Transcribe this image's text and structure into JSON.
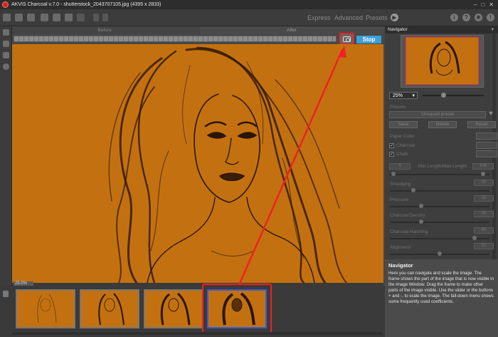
{
  "window": {
    "title": "AKVIS Charcoal v.7.0 - shutterstock_2043707105.jpg (4395 x 2833)"
  },
  "toolbar": {
    "modes": [
      "Express",
      "Advanced",
      "Presets"
    ]
  },
  "view_tabs": {
    "before": "Before",
    "after": "After"
  },
  "progress": {
    "stop_label": "Stop",
    "fraction": 1.0
  },
  "canvas": {
    "zoom_readout": "25.0%"
  },
  "navigator": {
    "title": "Navigator",
    "zoom_value": "25%"
  },
  "settings": {
    "presets_label": "Presets",
    "preset_selected": "Unsaved preset",
    "save_label": "Save",
    "delete_label": "Delete",
    "reset_label": "Reset",
    "paper_color_label": "Paper Color",
    "charcoal_label": "Charcoal",
    "chalk_label": "Chalk",
    "min_max_label": "Min Length/Max Length",
    "min_length_value": "5",
    "max_length_value": "100",
    "smudging_label": "Smudging",
    "smudging_value": "20",
    "pressure_label": "Pressure",
    "pressure_value": "30",
    "charcoal_density_label": "Charcoal Density",
    "charcoal_density_value": "30",
    "charcoal_hatching_label": "Charcoal Hatching",
    "charcoal_hatching_value": "85",
    "alignment_label": "Alignment",
    "alignment_value": "50"
  },
  "help": {
    "title": "Navigator",
    "text": "Here you can navigate and scale the image. The frame shows the part of the image that is now visible in the Image Window. Drag the frame to make other parts of the image visible. Use the slider or the buttons + and -, to scale the image. The fall-down menu shows some frequently used coefficients."
  },
  "colors": {
    "canvas_orange": "#c37110",
    "stop_blue": "#3aa0d8",
    "annotation_red": "#ee2222",
    "active_thumb_blue": "#3a5ad8"
  }
}
